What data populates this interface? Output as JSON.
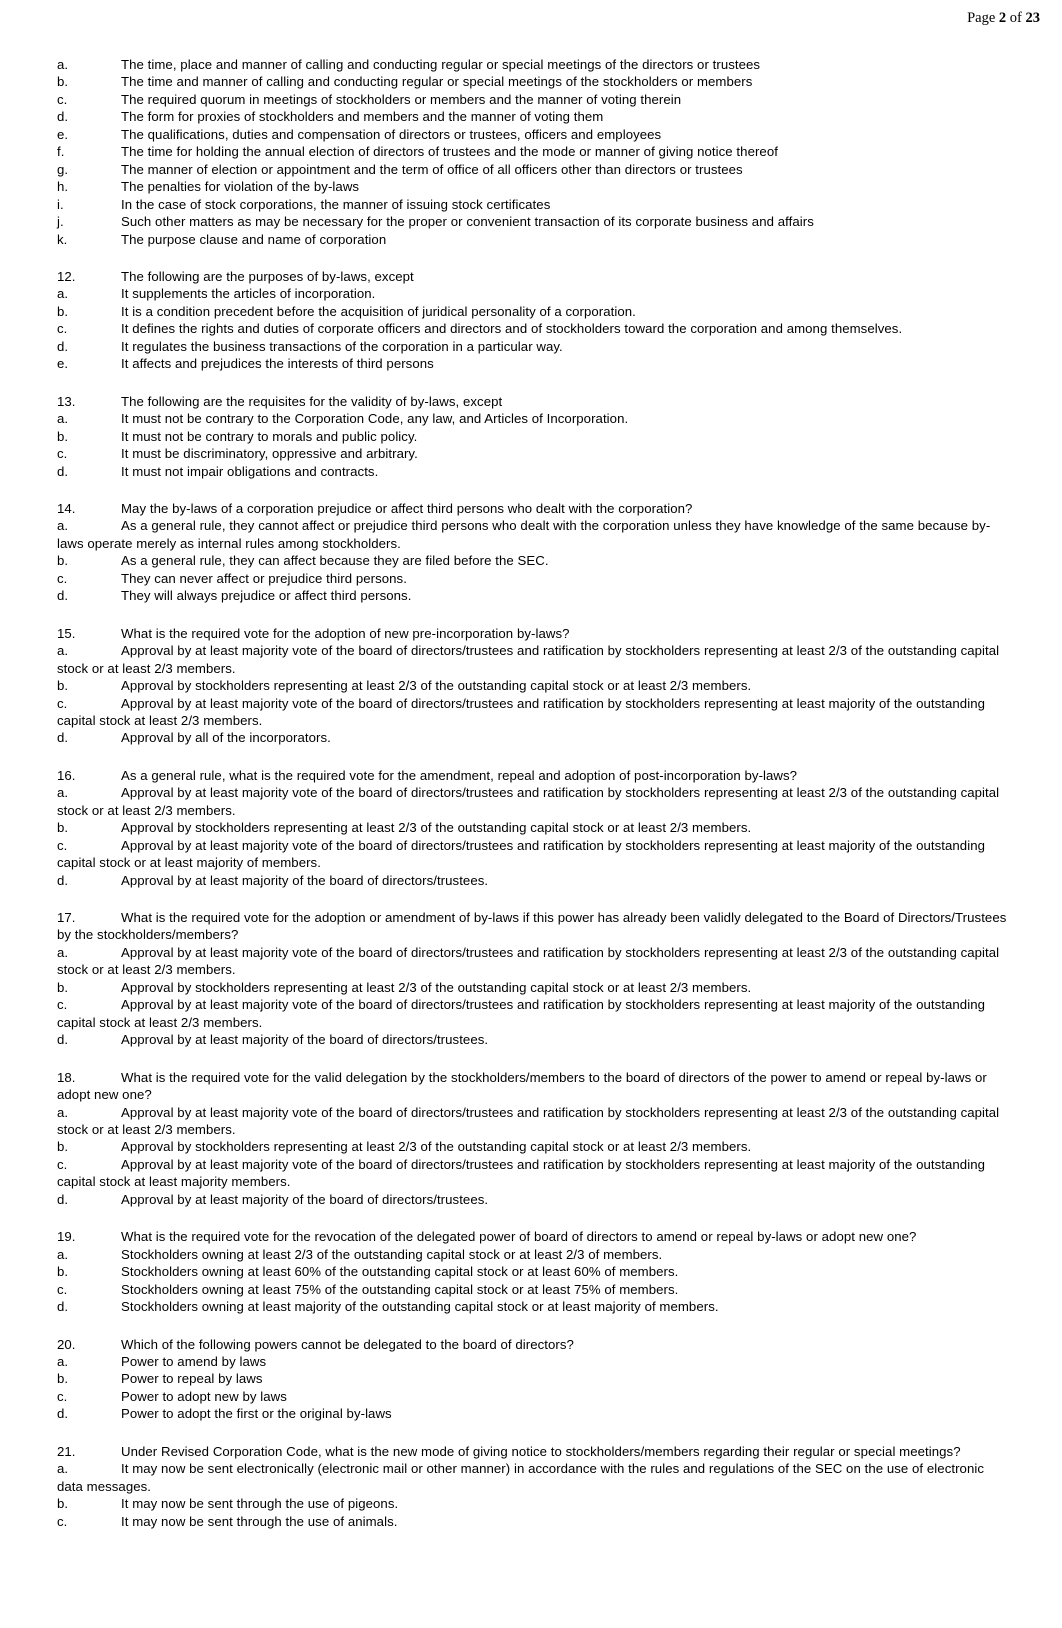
{
  "header": {
    "prefix": "Page ",
    "current_page": "2",
    "middle": " of ",
    "total_pages": "23",
    "full_text": "Page 2 of 23"
  },
  "document": {
    "blocks": [
      {
        "type": "list",
        "items": [
          {
            "label": "a.",
            "text": "The time, place and manner of calling and conducting regular or special meetings of the directors or trustees"
          },
          {
            "label": "b.",
            "text": "The time and manner of calling and conducting regular or special meetings of the stockholders or members"
          },
          {
            "label": "c.",
            "text": "The required quorum in meetings of stockholders or members and the manner of voting therein"
          },
          {
            "label": "d.",
            "text": "The form for proxies of stockholders and members and the manner of voting them"
          },
          {
            "label": "e.",
            "text": "The qualifications, duties and compensation of directors or trustees, officers and employees"
          },
          {
            "label": "f.",
            "text": "The time for holding the annual election of directors of trustees and the mode or manner of giving notice thereof"
          },
          {
            "label": "g.",
            "text": "The manner of election or appointment and the term of office of all officers other than directors or trustees"
          },
          {
            "label": "h.",
            "text": "The penalties for violation of the by-laws"
          },
          {
            "label": "i.",
            "text": "In the case of stock corporations, the manner of issuing stock certificates"
          },
          {
            "label": "j.",
            "text": "Such other matters as may be necessary for the proper or convenient transaction of its corporate business and affairs"
          },
          {
            "label": "k.",
            "text": "The purpose clause and name of corporation"
          }
        ]
      },
      {
        "type": "question",
        "number": "12.",
        "prompt": "The following are the purposes of by-laws, except",
        "choices": [
          {
            "label": "a.",
            "text": "It supplements the articles of incorporation."
          },
          {
            "label": "b.",
            "text": "It is a condition precedent before the acquisition of juridical personality of a corporation."
          },
          {
            "label": "c.",
            "text": "It defines the rights and duties of corporate officers and directors and of stockholders toward the corporation and among themselves."
          },
          {
            "label": "d.",
            "text": "It regulates the business transactions of the corporation in a particular way."
          },
          {
            "label": "e.",
            "text": "It affects and prejudices the interests of third persons"
          }
        ]
      },
      {
        "type": "question",
        "number": "13.",
        "prompt": "The following are the requisites for the validity of by-laws, except",
        "choices": [
          {
            "label": "a.",
            "text": "It must not be contrary to the Corporation Code, any law, and Articles of Incorporation."
          },
          {
            "label": "b.",
            "text": "It must not be contrary to morals and public policy."
          },
          {
            "label": "c.",
            "text": "It must be discriminatory, oppressive and arbitrary."
          },
          {
            "label": "d.",
            "text": "It must not impair obligations and contracts."
          }
        ]
      },
      {
        "type": "question",
        "number": "14.",
        "prompt": "May the by-laws of a corporation prejudice or affect third persons who dealt with the corporation?",
        "choices": [
          {
            "label": "a.",
            "text": "As a general rule, they cannot affect or prejudice third persons who dealt with the corporation unless they have knowledge of the same because by-laws operate merely as internal rules among stockholders."
          },
          {
            "label": "b.",
            "text": "As a general rule, they can affect because they are filed before the SEC."
          },
          {
            "label": "c.",
            "text": "They can never affect or prejudice third persons."
          },
          {
            "label": "d.",
            "text": "They will always prejudice or affect third persons."
          }
        ]
      },
      {
        "type": "question",
        "number": "15.",
        "prompt": "What is the required vote for the adoption of new pre-incorporation by-laws?",
        "choices": [
          {
            "label": "a.",
            "text": "Approval by at least majority vote of the board of directors/trustees and ratification by stockholders representing at least 2/3 of the outstanding capital stock or at least 2/3 members."
          },
          {
            "label": "b.",
            "text": "Approval by stockholders representing at least 2/3 of the outstanding capital stock or at least 2/3 members."
          },
          {
            "label": "c.",
            "text": "Approval by at least majority vote of the board of directors/trustees and ratification by stockholders representing at least majority of the outstanding capital stock at least 2/3 members."
          },
          {
            "label": "d.",
            "text": "Approval by all of the incorporators."
          }
        ]
      },
      {
        "type": "question",
        "number": "16.",
        "prompt": "As a general rule, what is the required vote for the amendment, repeal and adoption of post-incorporation by-laws?",
        "choices": [
          {
            "label": "a.",
            "text": "Approval by at least majority vote of the board of directors/trustees and ratification by stockholders representing at least 2/3 of the outstanding capital stock or at least 2/3 members."
          },
          {
            "label": "b.",
            "text": "Approval by stockholders representing at least 2/3 of the outstanding capital stock or at least 2/3 members."
          },
          {
            "label": "c.",
            "text": "Approval by at least majority vote of the board of directors/trustees and ratification by stockholders representing at least majority of the outstanding capital stock or at least majority of members."
          },
          {
            "label": "d.",
            "text": "Approval by at least majority of the board of directors/trustees."
          }
        ]
      },
      {
        "type": "question",
        "number": "17.",
        "prompt": "What is the required vote for the adoption or amendment of by-laws if this power has already been validly delegated to the Board of Directors/Trustees by the stockholders/members?",
        "choices": [
          {
            "label": "a.",
            "text": "Approval by at least majority vote of the board of directors/trustees and ratification by stockholders representing at least 2/3 of the outstanding capital stock or at least 2/3 members."
          },
          {
            "label": "b.",
            "text": "Approval by stockholders representing at least 2/3 of the outstanding capital stock or at least 2/3 members."
          },
          {
            "label": "c.",
            "text": "Approval by at least majority vote of the board of directors/trustees and ratification by stockholders representing at least majority of the outstanding capital stock at least 2/3 members."
          },
          {
            "label": "d.",
            "text": "Approval by at least majority of the board of directors/trustees."
          }
        ]
      },
      {
        "type": "question",
        "number": "18.",
        "prompt": "What is the required vote for the valid delegation by the stockholders/members to the board of directors of the power to amend or repeal by-laws or adopt new one?",
        "choices": [
          {
            "label": "a.",
            "text": "Approval by at least majority vote of the board of directors/trustees and ratification by stockholders representing at least 2/3 of the outstanding capital stock or at least 2/3 members."
          },
          {
            "label": "b.",
            "text": "Approval by stockholders representing at least 2/3 of the outstanding capital stock or at least 2/3 members."
          },
          {
            "label": "c.",
            "text": "Approval by at least majority vote of the board of directors/trustees and ratification by stockholders representing at least majority of the outstanding capital stock at least majority members."
          },
          {
            "label": "d.",
            "text": "Approval by at least majority of the board of directors/trustees."
          }
        ]
      },
      {
        "type": "question",
        "number": "19.",
        "prompt": "What is the required vote for the revocation of the delegated power of board of directors to amend or repeal by-laws or adopt new one?",
        "choices": [
          {
            "label": "a.",
            "text": "Stockholders owning at least 2/3 of the outstanding capital stock or at least 2/3 of members."
          },
          {
            "label": "b.",
            "text": "Stockholders owning at least 60% of the outstanding capital stock or at least 60% of members."
          },
          {
            "label": "c.",
            "text": "Stockholders owning at least 75% of the outstanding capital stock or at least 75% of members."
          },
          {
            "label": "d.",
            "text": "Stockholders owning at least majority of the outstanding capital stock or at least majority of members."
          }
        ]
      },
      {
        "type": "question",
        "number": "20.",
        "prompt": "Which of the following powers cannot be delegated to the board of directors?",
        "choices": [
          {
            "label": "a.",
            "text": "Power to amend by laws"
          },
          {
            "label": "b.",
            "text": "Power to repeal by laws"
          },
          {
            "label": "c.",
            "text": "Power to adopt new by laws"
          },
          {
            "label": "d.",
            "text": "Power to adopt the first or the original by-laws"
          }
        ]
      },
      {
        "type": "question",
        "number": "21.",
        "prompt": "Under Revised Corporation Code, what is the new mode of giving notice to stockholders/members regarding their regular or special meetings?",
        "choices": [
          {
            "label": "a.",
            "text": "It may now be sent electronically (electronic mail or other manner) in accordance with the rules and regulations of the SEC on the use of electronic data messages."
          },
          {
            "label": "b.",
            "text": "It may now be sent through the use of pigeons."
          },
          {
            "label": "c.",
            "text": "It may now be sent through the use of animals."
          }
        ]
      }
    ]
  }
}
